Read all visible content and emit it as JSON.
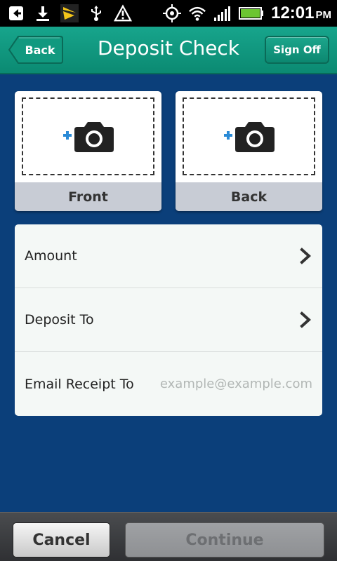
{
  "status_bar": {
    "time": "12:01",
    "ampm": "PM",
    "icons": [
      "back-arrow-icon",
      "download-icon",
      "sprint-logo-icon",
      "usb-icon",
      "warning-icon",
      "gps-icon",
      "wifi-icon",
      "signal-icon",
      "battery-icon"
    ]
  },
  "header": {
    "title": "Deposit Check",
    "back_label": "Back",
    "signoff_label": "Sign Off",
    "color": "#109a80"
  },
  "photos": {
    "front_label": "Front",
    "back_label": "Back"
  },
  "form": {
    "amount_label": "Amount",
    "deposit_to_label": "Deposit To",
    "email_label": "Email Receipt To",
    "email_placeholder": "example@example.com",
    "email_value": ""
  },
  "bottom": {
    "cancel_label": "Cancel",
    "continue_label": "Continue"
  },
  "colors": {
    "background": "#0b3f7a",
    "accent_plus": "#2a8ad6"
  }
}
